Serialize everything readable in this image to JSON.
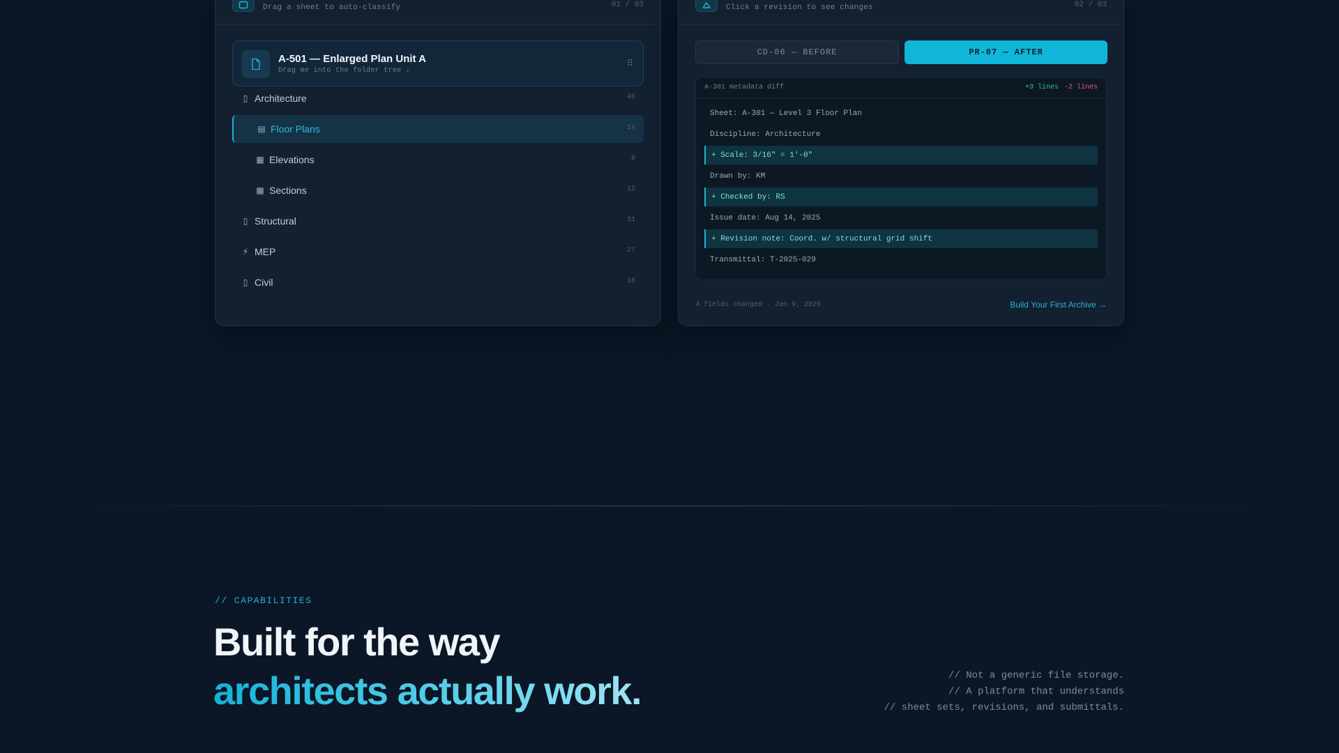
{
  "left_card": {
    "head_icon": "folder-icon",
    "subtitle": "Drag a sheet to auto-classify",
    "counter": "01 / 03",
    "drag_item": {
      "icon": "document-icon",
      "title": "A-501 — Enlarged Plan Unit A",
      "subtitle": "Drag me into the folder tree ↓",
      "handle_icon": "drag-handle-icon"
    },
    "tree": [
      {
        "label": "Architecture",
        "count": "46",
        "icon": "folder-icon",
        "glyph": "▯",
        "level": 0,
        "active": false
      },
      {
        "label": "Floor Plans",
        "count": "14",
        "icon": "floorplan-icon",
        "glyph": "▤",
        "level": 1,
        "active": true
      },
      {
        "label": "Elevations",
        "count": "8",
        "icon": "elevation-icon",
        "glyph": "▦",
        "level": 1,
        "active": false
      },
      {
        "label": "Sections",
        "count": "12",
        "icon": "section-icon",
        "glyph": "▩",
        "level": 1,
        "active": false
      },
      {
        "label": "Structural",
        "count": "31",
        "icon": "folder-icon",
        "glyph": "▯",
        "level": 0,
        "active": false
      },
      {
        "label": "MEP",
        "count": "27",
        "icon": "lightning-icon",
        "glyph": "⚡",
        "level": 0,
        "active": false
      },
      {
        "label": "Civil",
        "count": "18",
        "icon": "folder-icon",
        "glyph": "▯",
        "level": 0,
        "active": false
      }
    ]
  },
  "right_card": {
    "head_icon": "diff-icon",
    "subtitle": "Click a revision to see changes",
    "counter": "02 / 03",
    "before_label": "CD-06 — BEFORE",
    "after_label": "PR-07 — AFTER",
    "diff": {
      "title": "A-301 metadata diff",
      "added": "+3 lines",
      "removed": "-2 lines",
      "lines": [
        {
          "text": "Sheet: A-301 — Level 3 Floor Plan",
          "added": false
        },
        {
          "text": "Discipline: Architecture",
          "added": false
        },
        {
          "text": "+ Scale: 3/16\" = 1'-0\"",
          "added": true
        },
        {
          "text": "Drawn by: KM",
          "added": false
        },
        {
          "text": "+ Checked by: RS",
          "added": true
        },
        {
          "text": "Issue date: Aug 14, 2025",
          "added": false
        },
        {
          "text": "+ Revision note: Coord. w/ structural grid shift",
          "added": true
        },
        {
          "text": "Transmittal: T-2025-029",
          "added": false
        }
      ]
    },
    "footer_meta": "4 fields changed · Jan 9, 2026",
    "footer_link": "Build Your First Archive →"
  },
  "capabilities": {
    "tag": "// CAPABILITIES",
    "headline_line1": "Built for the way",
    "headline_line2": "architects actually work.",
    "note_lines": [
      "// Not a generic file storage.",
      "// A platform that understands",
      "// sheet sets, revisions, and submittals."
    ]
  },
  "colors": {
    "background": "#0b1726",
    "accent": "#1fb3d6",
    "added": "#36c988",
    "removed": "#e35d6a"
  }
}
